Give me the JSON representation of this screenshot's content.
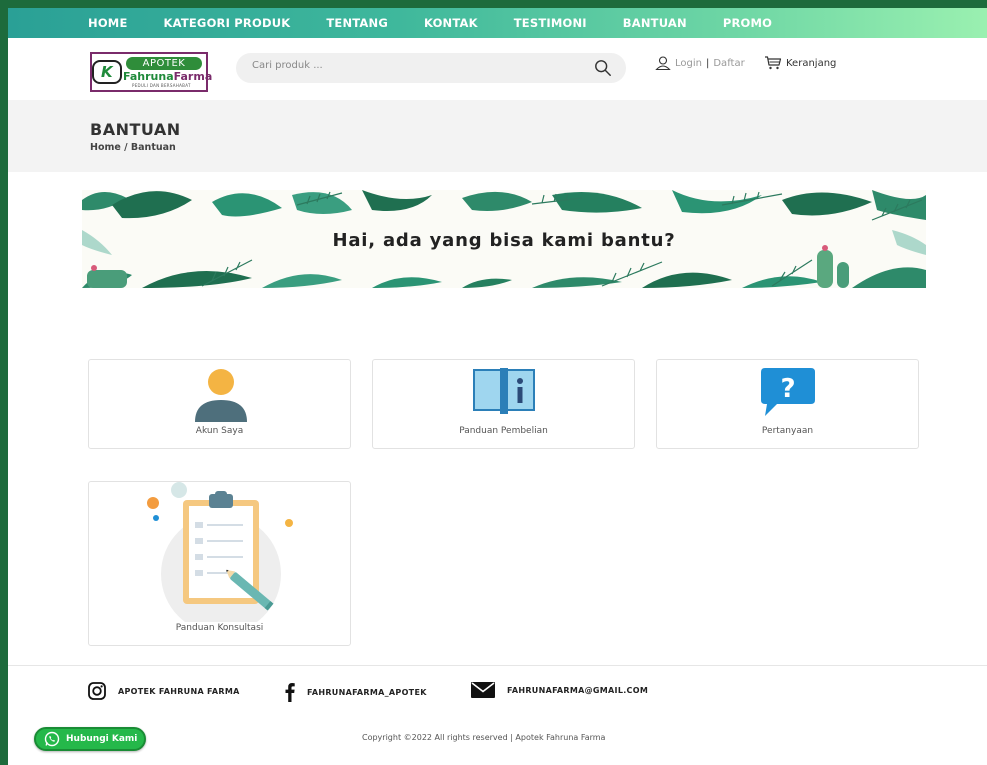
{
  "nav": {
    "items": [
      "HOME",
      "KATEGORI PRODUK",
      "TENTANG",
      "KONTAK",
      "TESTIMONI",
      "BANTUAN",
      "PROMO"
    ]
  },
  "logo": {
    "pill": "APOTEK",
    "name_part1": "Fahruna",
    "name_part2": "Farma",
    "tagline": "PEDULI DAN BERSAHABAT"
  },
  "search": {
    "placeholder": "Cari produk ..."
  },
  "account": {
    "login": "Login",
    "separator": "|",
    "register": "Daftar"
  },
  "cart": {
    "label": "Keranjang"
  },
  "page": {
    "title": "BANTUAN",
    "breadcrumb": "Home / Bantuan"
  },
  "banner": {
    "text": "Hai, ada yang bisa kami bantu?"
  },
  "help_cards": [
    {
      "label": "Akun Saya",
      "icon": "user-icon"
    },
    {
      "label": "Panduan Pembelian",
      "icon": "book-info-icon"
    },
    {
      "label": "Pertanyaan",
      "icon": "question-bubble-icon"
    },
    {
      "label": "Panduan Konsultasi",
      "icon": "clipboard-icon"
    }
  ],
  "footer": {
    "instagram": "APOTEK FAHRUNA FARMA",
    "facebook": "FAHRUNAFARMA_APOTEK",
    "email": "FAHRUNAFARMA@GMAIL.COM",
    "copyright": "Copyright ©2022 All rights reserved | Apotek Fahruna Farma"
  },
  "whatsapp": {
    "label": "Hubungi Kami"
  },
  "colors": {
    "nav_start": "#2aa096",
    "nav_end": "#9af0b0",
    "brand_green": "#1f8a3a",
    "brand_purple": "#7a2b6b",
    "whatsapp": "#25b84a"
  }
}
